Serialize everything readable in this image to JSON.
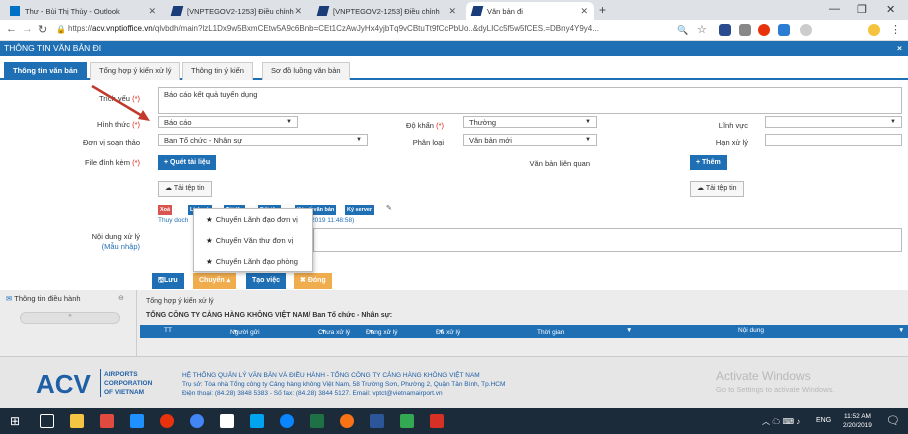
{
  "browser": {
    "tabs": [
      {
        "title": "Thư - Bùi Thị Thùy - Outlook",
        "icon_color": "#0072c6"
      },
      {
        "title": "[VNPTEGOV2-1253] Điều chỉnh",
        "icon_color": "#1a3d7a"
      },
      {
        "title": "[VNPTEGOV2-1253] Điều chỉnh",
        "icon_color": "#1a3d7a"
      },
      {
        "title": "Văn bản đi",
        "icon_color": "#1a3d7a"
      }
    ],
    "new_tab": "+",
    "url_prefix": "https://",
    "url_host": "acv.vnptioffice.vn",
    "url_rest": "/qlvbdh/main?lzL1Dx9w5BxmCEtw5A9c6Bnb=CEt1CzAwJyHx4yjbTq9vCBtuTt9fCcPbUo..&dyLICc5f5w5fCES.=DBny4Y9y4..."
  },
  "header": {
    "title": "THÔNG TIN VĂN BẢN ĐI",
    "close": "×"
  },
  "subtabs": [
    "Thông tin văn bản",
    "Tổng hợp ý kiến xử lý",
    "Thông tin ý kiến",
    "Sơ đồ luồng văn bản"
  ],
  "form": {
    "trich_yeu_label": "Trích yếu",
    "trich_yeu_value": "Báo cáo kết quả tuyển dụng",
    "hinh_thuc_label": "Hình thức",
    "hinh_thuc_value": "Báo cáo",
    "do_khan_label": "Độ khẩn",
    "do_khan_value": "Thường",
    "linh_vuc_label": "Lĩnh vực",
    "linh_vuc_value": "",
    "don_vi_label": "Đơn vị soạn thảo",
    "don_vi_value": "Ban Tổ chức - Nhân sự",
    "phan_loai_label": "Phân loại",
    "phan_loai_value": "Văn bản mới",
    "han_xu_ly_label": "Hạn xử lý",
    "han_xu_ly_value": "",
    "file_label": "File đính kèm",
    "quet_tai_lieu": "+ Quét tài liệu",
    "van_ban_lien_quan_label": "Văn bản liên quan",
    "them": "+ Thêm",
    "tai_tep_tin": "Tải tệp tin",
    "tai_tep_tin_right": "Tải tệp tin",
    "file_actions": [
      "Xoá",
      "Lịch sử",
      "Tải lên",
      "Đổi tên",
      "Ký số văn bản",
      "Ký server"
    ],
    "file_uploader": "Thuy doch",
    "file_time": "2019 11:48:58)",
    "noi_dung_label": "Nội dung xử lý",
    "mau_nhap": "(Mẫu nhập)"
  },
  "dropdown": [
    "Chuyển Lãnh đạo đơn vị",
    "Chuyển Văn thư đơn vị",
    "Chuyển Lãnh đạo phòng"
  ],
  "actions": {
    "luu": "Lưu",
    "chuyen": "Chuyển",
    "tao_viec": "Tạo việc",
    "dong": "Đóng"
  },
  "below": {
    "left_nav": "Thông tin điều hành",
    "breadcrumb": "Tổng hợp ý kiến xử lý",
    "company_line": "TỔNG CÔNG TY CẢNG HÀNG KHÔNG VIỆT NAM/ Ban Tổ chức - Nhân sự:",
    "table_headers": [
      "TT",
      "Người gửi",
      "Chưa xử lý",
      "Đang xử lý",
      "Đã xử lý",
      "Thời gian",
      "Nội dung"
    ]
  },
  "footer": {
    "logo": "ACV",
    "logo_lines": [
      "AIRPORTS",
      "CORPORATION",
      "OF VIETNAM"
    ],
    "system_title": "HỆ THỐNG QUẢN LÝ VĂN BẢN VÀ ĐIỀU HÀNH - TỔNG CÔNG TY CẢNG HÀNG KHÔNG VIỆT NAM",
    "address": "Trụ sở: Tòa nhà Tổng công ty Cảng hàng không Việt Nam, 58 Trường Sơn, Phường 2, Quận Tân Bình, Tp.HCM",
    "contact": "Điện thoại: (84.28) 3848 5383 - Số fax: (84.28) 3844 5127. Email: vptct@vietnamairport.vn",
    "watermark_1": "Activate Windows",
    "watermark_2": "Go to Settings to activate Windows."
  },
  "taskbar": {
    "lang": "ENG",
    "time": "11:52 AM",
    "date": "2/20/2019"
  },
  "colors": {
    "primary": "#1f6fb5",
    "chuyen": "#f0ad4e",
    "dong": "#f0ad4e",
    "required": "#d9241a",
    "arrow": "#c0392b"
  }
}
